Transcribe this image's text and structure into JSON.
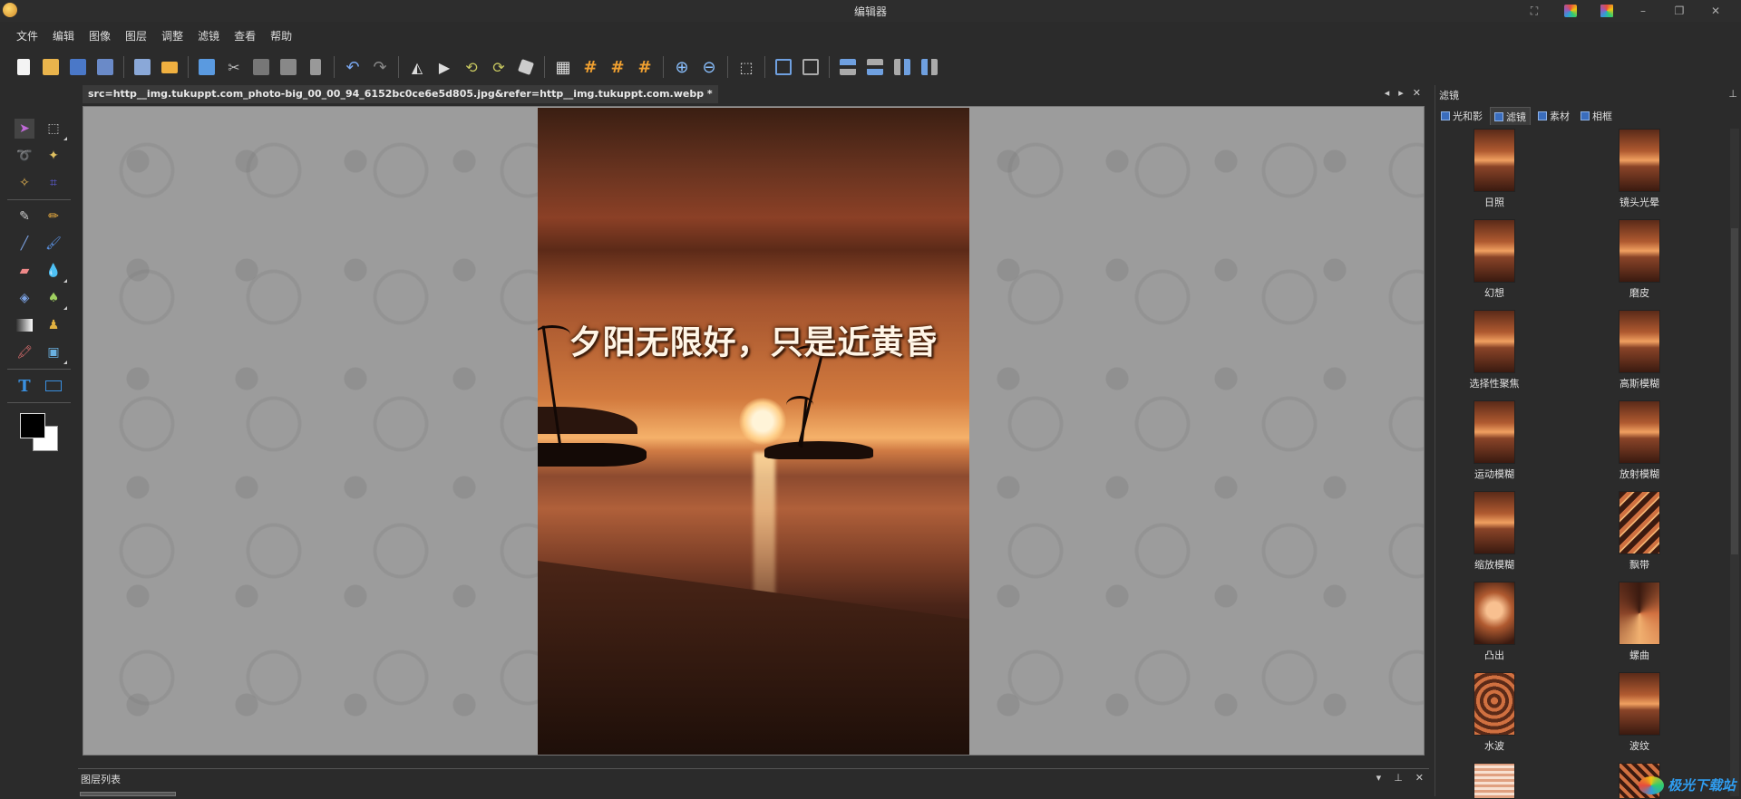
{
  "window": {
    "title": "编辑器"
  },
  "menu": [
    "文件",
    "编辑",
    "图像",
    "图层",
    "调整",
    "滤镜",
    "查看",
    "帮助"
  ],
  "toolbar": {
    "icons": [
      "new-icon",
      "open-icon",
      "save-icon",
      "save-as-icon",
      "print-icon",
      "email-icon",
      "copy-icon",
      "cut-icon",
      "paste-icon",
      "paste-new-icon",
      "delete-icon",
      "undo-icon",
      "redo-icon",
      "flip-horizontal-icon",
      "flip-vertical-icon",
      "rotate-left-icon",
      "rotate-right-icon",
      "rotate-icon",
      "grid-icon",
      "grid-snap-icon",
      "grid-snap-2-icon",
      "grid-snap-3-icon",
      "zoom-in-icon",
      "zoom-out-icon",
      "select-icon",
      "crop-icon",
      "resize-icon",
      "align-left-icon",
      "align-center-icon",
      "align-right-icon",
      "align-bottom-icon"
    ]
  },
  "document": {
    "tab_title": "src=http__img.tukuppt.com_photo-big_00_00_94_6152bc0ce6e5d805.jpg&refer=http__img.tukuppt.com.webp *",
    "caption": "夕阳无限好，只是近黄昏"
  },
  "layers": {
    "label": "图层列表"
  },
  "right_panel": {
    "title": "滤镜",
    "tabs": [
      "光和影",
      "滤镜",
      "素材",
      "相框"
    ],
    "active_tab": 1,
    "filters": [
      "日照",
      "镜头光晕",
      "幻想",
      "磨皮",
      "选择性聚焦",
      "高斯模糊",
      "运动模糊",
      "放射模糊",
      "缩放模糊",
      "飘带",
      "凸出",
      "螺曲",
      "水波",
      "波纹"
    ]
  },
  "watermark": "极光下载站",
  "colors": {
    "foreground": "#000000",
    "background": "#ffffff",
    "accent": "#3a6dbd"
  }
}
